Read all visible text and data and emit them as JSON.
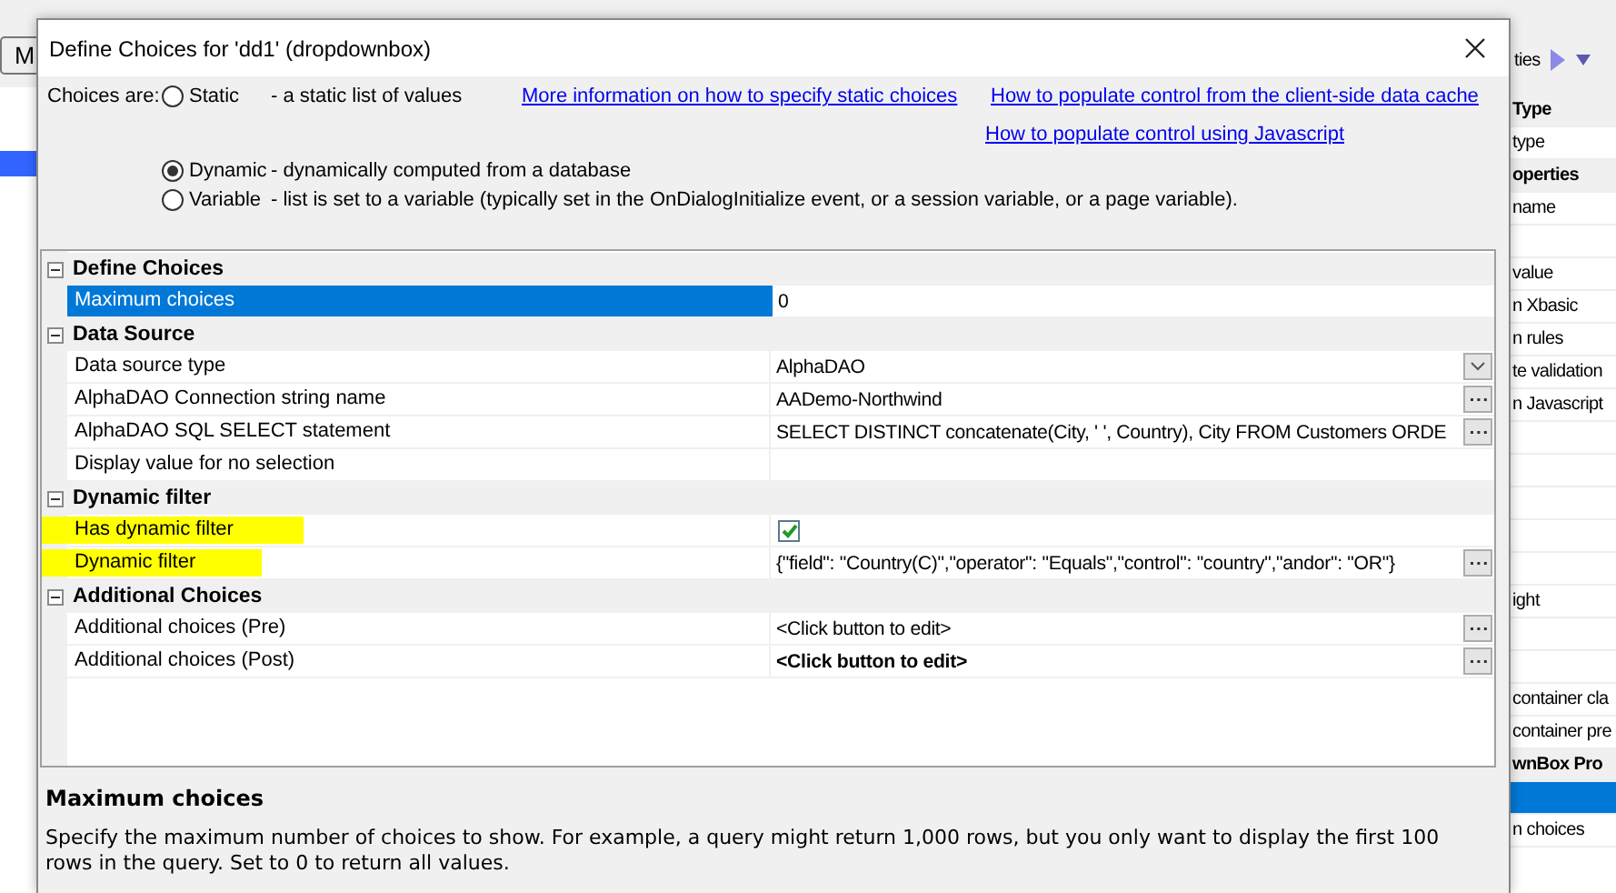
{
  "left_panel": {
    "tab": "M",
    "row_selected": true
  },
  "right_panel": {
    "tab": "ties",
    "rows": [
      {
        "kind": "header",
        "label": "Type",
        "selected": false
      },
      {
        "kind": "row",
        "label": "type",
        "selected": false
      },
      {
        "kind": "header",
        "label": "operties",
        "selected": false
      },
      {
        "kind": "row",
        "label": "name",
        "selected": false
      },
      {
        "kind": "row",
        "selected": false
      },
      {
        "kind": "row",
        "label": "value",
        "selected": false
      },
      {
        "kind": "row",
        "label": "n Xbasic",
        "selected": false
      },
      {
        "kind": "row",
        "label": "n rules",
        "selected": false
      },
      {
        "kind": "row",
        "label": "te validation",
        "selected": false
      },
      {
        "kind": "row",
        "label": "n Javascript",
        "selected": false
      },
      {
        "kind": "row",
        "selected": false
      },
      {
        "kind": "row",
        "selected": false
      },
      {
        "kind": "row",
        "selected": false
      },
      {
        "kind": "row",
        "selected": false
      },
      {
        "kind": "row",
        "selected": false
      },
      {
        "kind": "row",
        "label": "ight",
        "selected": false
      },
      {
        "kind": "row",
        "selected": false
      },
      {
        "kind": "row",
        "selected": false
      },
      {
        "kind": "row",
        "label": "container cla",
        "selected": false
      },
      {
        "kind": "row",
        "label": "container pre",
        "selected": false
      },
      {
        "kind": "header",
        "label": "wnBox Pro",
        "selected": false
      },
      {
        "kind": "row",
        "selected": true
      },
      {
        "kind": "row",
        "label": "n choices",
        "selected": false
      }
    ]
  },
  "dialog": {
    "title": "Define Choices for 'dd1' (dropdownbox)",
    "choices_label": "Choices are:",
    "options": [
      {
        "label": "Static",
        "description": "- a static list of values",
        "selected": false
      },
      {
        "label": "Dynamic",
        "description": "- dynamically computed from a database",
        "selected": true
      },
      {
        "label": "Variable",
        "description": "- list is set to a variable (typically set in the OnDialogInitialize event, or a session variable, or a page variable).",
        "selected": false
      }
    ],
    "links": [
      "More information on how to specify static choices",
      "How to populate control from the client-side data cache",
      "How to populate control using Javascript"
    ],
    "property_grid": {
      "categories": [
        {
          "title": "Define Choices",
          "expanded": true,
          "rows": [
            {
              "name": "Maximum choices",
              "kind": "text",
              "value": "0",
              "bold": false,
              "selected": true,
              "highlighted": false
            }
          ]
        },
        {
          "title": "Data Source",
          "expanded": true,
          "rows": [
            {
              "name": "Data source type",
              "kind": "dropdown",
              "value": "AlphaDAO",
              "bold": false,
              "selected": false,
              "highlighted": false
            },
            {
              "name": "AlphaDAO Connection string name",
              "kind": "ellipsis",
              "value": "AADemo-Northwind",
              "bold": false,
              "selected": false,
              "highlighted": false
            },
            {
              "name": "AlphaDAO SQL SELECT statement",
              "kind": "ellipsis",
              "value": "SELECT DISTINCT concatenate(City, ' ', Country), City FROM Customers ORDE",
              "bold": false,
              "selected": false,
              "highlighted": false
            },
            {
              "name": "Display value for no selection",
              "kind": "text",
              "selected": false,
              "highlighted": false
            }
          ]
        },
        {
          "title": "Dynamic filter",
          "expanded": true,
          "rows": [
            {
              "name": "Has dynamic filter",
              "kind": "checkbox",
              "checked": true,
              "selected": false,
              "highlighted": true
            },
            {
              "name": "Dynamic filter",
              "kind": "ellipsis",
              "value": "{\"field\": \"Country(C)\",\"operator\": \"Equals\",\"control\": \"country\",\"andor\": \"OR\"}",
              "bold": false,
              "selected": false,
              "highlighted": true
            }
          ]
        },
        {
          "title": "Additional Choices",
          "expanded": true,
          "rows": [
            {
              "name": "Additional choices (Pre)",
              "kind": "ellipsis",
              "value": "<Click button to edit>",
              "bold": false,
              "selected": false,
              "highlighted": false
            },
            {
              "name": "Additional choices (Post)",
              "kind": "ellipsis",
              "value": "<Click button to edit>",
              "bold": true,
              "selected": false,
              "highlighted": false
            }
          ]
        }
      ]
    },
    "description": {
      "title": "Maximum choices",
      "text": "Specify the maximum number of choices to show. For example, a query might return 1,000 rows, but you only want to display the first 100 rows in the query. Set to 0 to return all values."
    }
  }
}
